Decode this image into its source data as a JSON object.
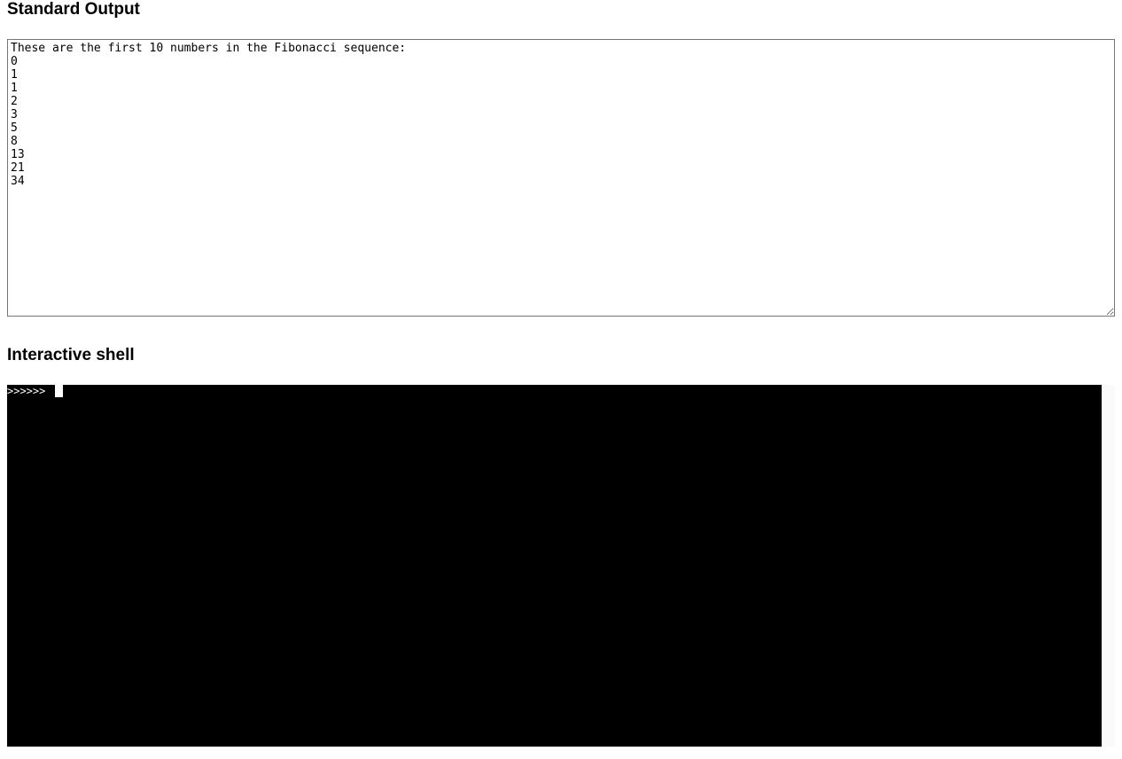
{
  "sections": {
    "stdout": {
      "title": "Standard Output",
      "content": "These are the first 10 numbers in the Fibonacci sequence:\n0\n1\n1\n2\n3\n5\n8\n13\n21\n34"
    },
    "shell": {
      "title": "Interactive shell",
      "prompt": ">>>>>> "
    }
  }
}
